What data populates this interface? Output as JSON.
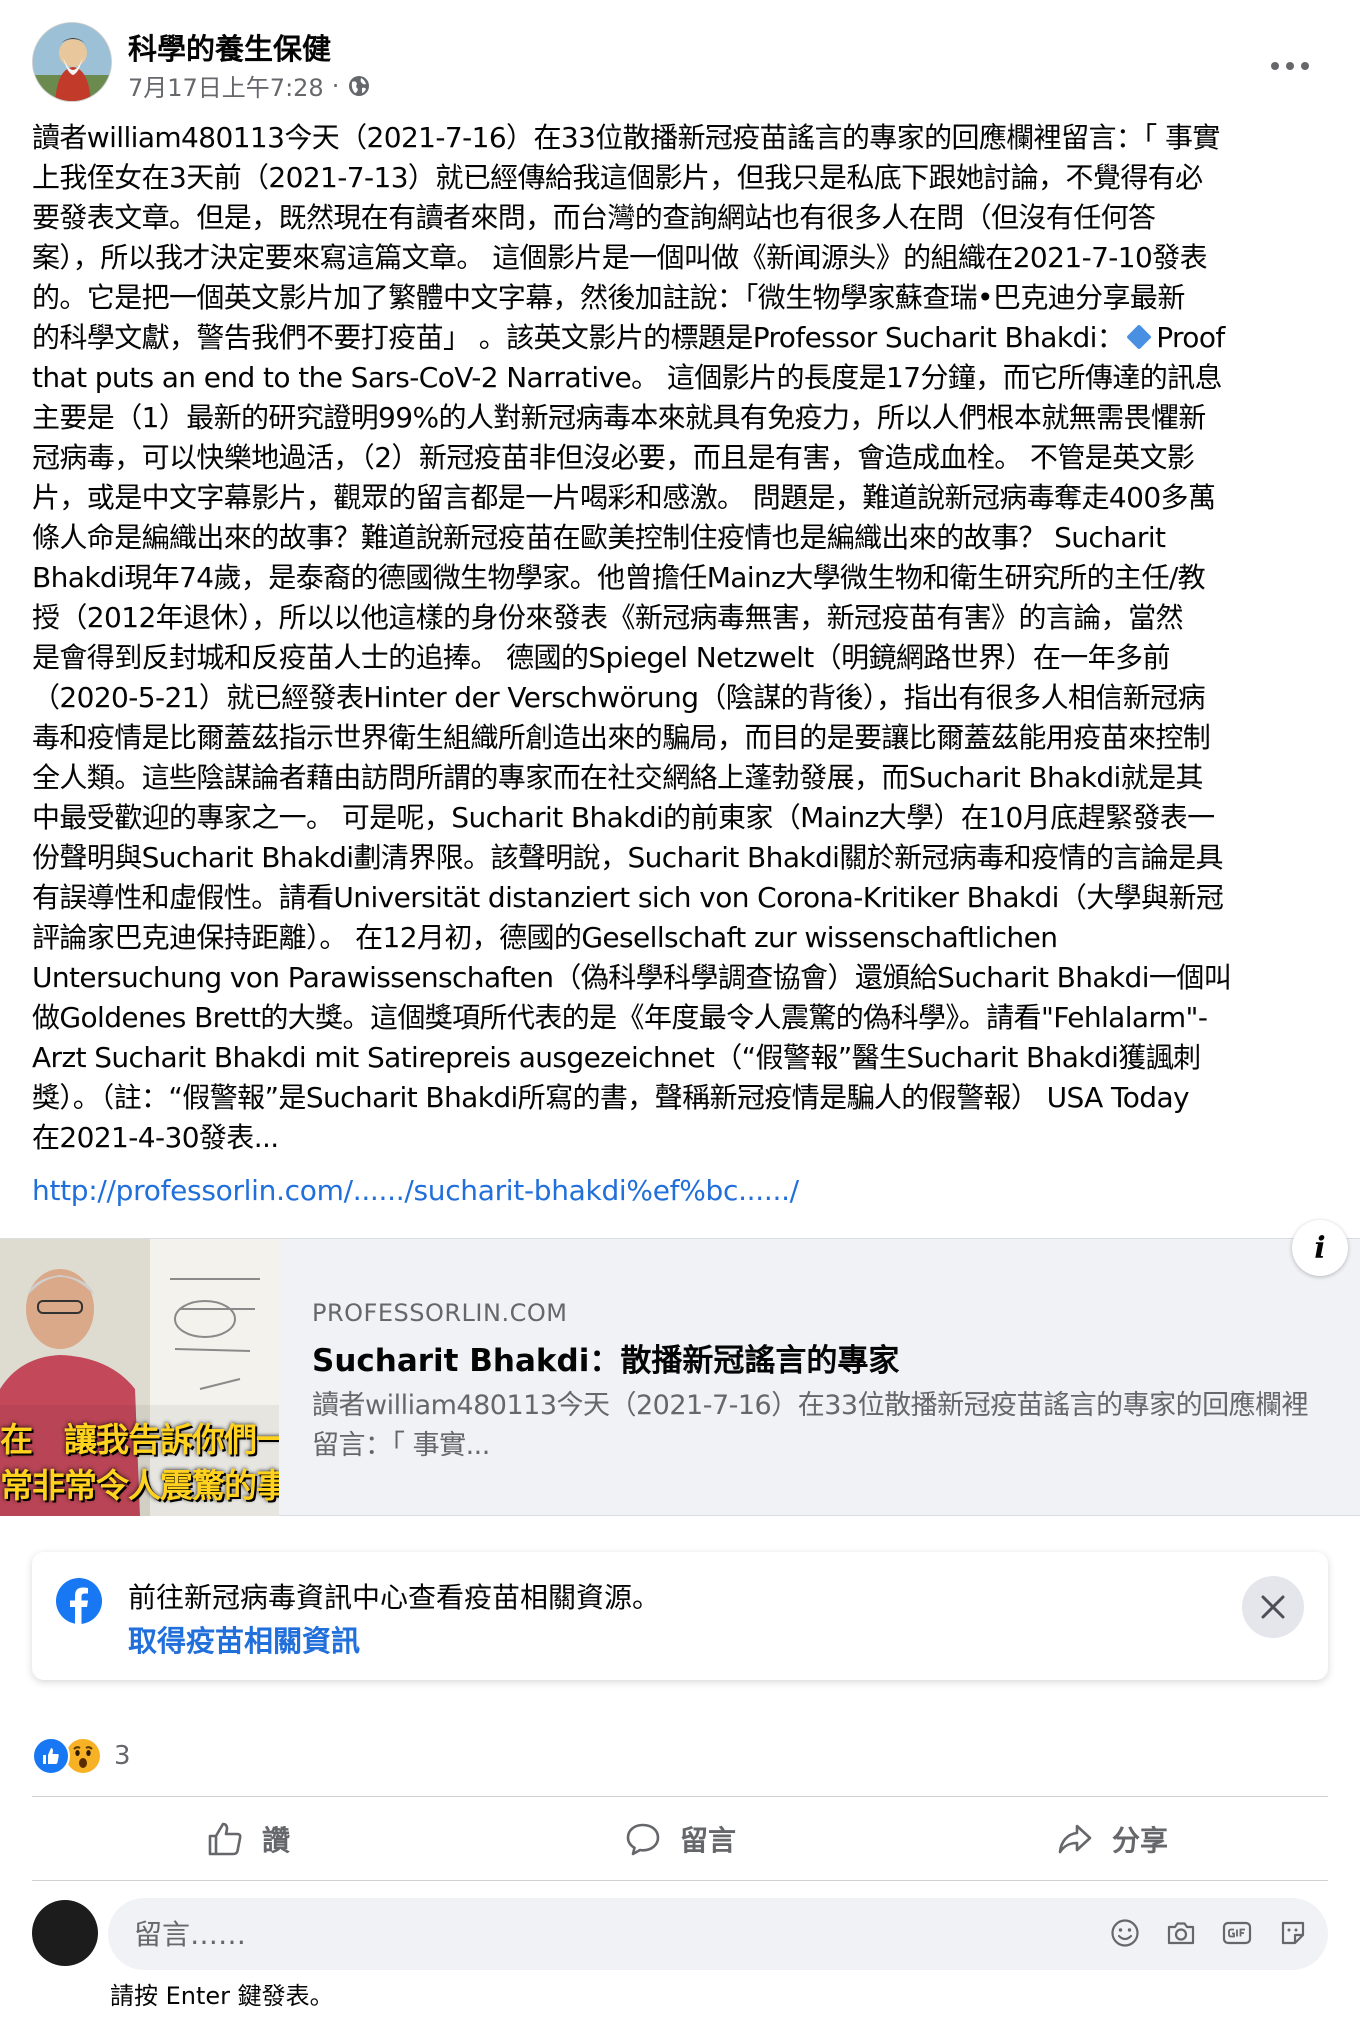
{
  "post": {
    "page_name": "科學的養生保健",
    "timestamp": "7月17日上午7:28",
    "audience_icon": "globe-icon",
    "more_icon": "more-options-icon",
    "text_lines": [
      "讀者william480113今天（2021-7-16）在33位散播新冠疫苗謠言的專家的回應欄裡留言：「 事實",
      "上我侄女在3天前（2021-7-13）就已經傳給我這個影片，但我只是私底下跟她討論，不覺得有必",
      "要發表文章。但是，既然現在有讀者來問，而台灣的查詢網站也有很多人在問（但沒有任何答",
      "案），所以我才決定要來寫這篇文章。 這個影片是一個叫做《新闻源头》的組織在2021-7-10發表",
      "的。它是把一個英文影片加了繁體中文字幕，然後加註說：「微生物學家蘇查瑞•巴克迪分享最新",
      "的科學文獻，警告我們不要打疫苗」 。該英文影片的標題是Professor Sucharit Bhakdi：",
      "that puts an end to the Sars-CoV-2 Narrative。 這個影片的長度是17分鐘，而它所傳達的訊息",
      "主要是（1）最新的研究證明99%的人對新冠病毒本來就具有免疫力，所以人們根本就無需畏懼新",
      "冠病毒，可以快樂地過活，（2）新冠疫苗非但沒必要，而且是有害，會造成血栓。 不管是英文影",
      "片，或是中文字幕影片，觀眾的留言都是一片喝彩和感激。 問題是，難道說新冠病毒奪走400多萬",
      "條人命是編織出來的故事？難道說新冠疫苗在歐美控制住疫情也是編織出來的故事？ Sucharit",
      "Bhakdi現年74歲，是泰裔的德國微生物學家。他曾擔任Mainz大學微生物和衛生研究所的主任/教",
      "授（2012年退休），所以以他這樣的身份來發表《新冠病毒無害，新冠疫苗有害》的言論，當然",
      "是會得到反封城和反疫苗人士的追捧。 德國的Spiegel Netzwelt（明鏡網路世界）在一年多前",
      "（2020-5-21）就已經發表Hinter der Verschwörung（陰謀的背後），指出有很多人相信新冠病",
      "毒和疫情是比爾蓋茲指示世界衛生組織所創造出來的騙局，而目的是要讓比爾蓋茲能用疫苗來控制",
      "全人類。這些陰謀論者藉由訪問所謂的專家而在社交網絡上蓬勃發展，而Sucharit Bhakdi就是其",
      "中最受歡迎的專家之一。 可是呢，Sucharit Bhakdi的前東家（Mainz大學）在10月底趕緊發表一",
      "份聲明與Sucharit Bhakdi劃清界限。該聲明說，Sucharit Bhakdi關於新冠病毒和疫情的言論是具",
      "有誤導性和虛假性。請看Universität distanziert sich von Corona-Kritiker Bhakdi（大學與新冠",
      "評論家巴克迪保持距離）。 在12月初，德國的Gesellschaft zur wissenschaftlichen",
      "Untersuchung von Parawissenschaften（偽科學科學調查協會）還頒給Sucharit Bhakdi一個叫",
      "做Goldenes Brett的大獎。這個獎項所代表的是《年度最令人震驚的偽科學》。請看\"Fehlalarm\"-",
      "Arzt Sucharit Bhakdi mit Satirepreis ausgezeichnet（“假警報”醫生Sucharit Bhakdi獲諷刺",
      "獎）。（註：“假警報”是Sucharit Bhakdi所寫的書，聲稱新冠疫情是騙人的假警報） USA Today",
      "在2021-4-30發表..."
    ],
    "inline_proof_word": "Proof",
    "link_url": "http://professorlin.com/....../sucharit-bhakdi%ef%bc....../"
  },
  "link_card": {
    "domain": "PROFESSORLIN.COM",
    "title": "Sucharit Bhakdi：散播新冠謠言的專家",
    "description": "讀者william480113今天（2021-7-16）在33位散播新冠疫苗謠言的專家的回應欄裡留言：「 事實...",
    "thumbnail_caption_line1": "在　讓我告訴你們一",
    "thumbnail_caption_line2": "常非常令人震驚的事",
    "info_label": "i"
  },
  "covid_banner": {
    "text": "前往新冠病毒資訊中心查看疫苗相關資源。",
    "link_label": "取得疫苗相關資訊",
    "icon": "facebook-icon",
    "close_icon": "close-icon"
  },
  "reactions": {
    "icons": [
      "like-reaction-icon",
      "wow-reaction-icon"
    ],
    "count": "3"
  },
  "actions": {
    "like_label": "讚",
    "comment_label": "留言",
    "share_label": "分享"
  },
  "comment": {
    "placeholder": "留言……",
    "hint": "請按 Enter 鍵發表。",
    "tools": [
      "emoji-icon",
      "camera-icon",
      "gif-icon",
      "sticker-icon"
    ]
  },
  "colors": {
    "link": "#216fdb",
    "secondary_text": "#65676b",
    "facebook_blue": "#1877f2",
    "card_background": "#f0f2f5"
  }
}
